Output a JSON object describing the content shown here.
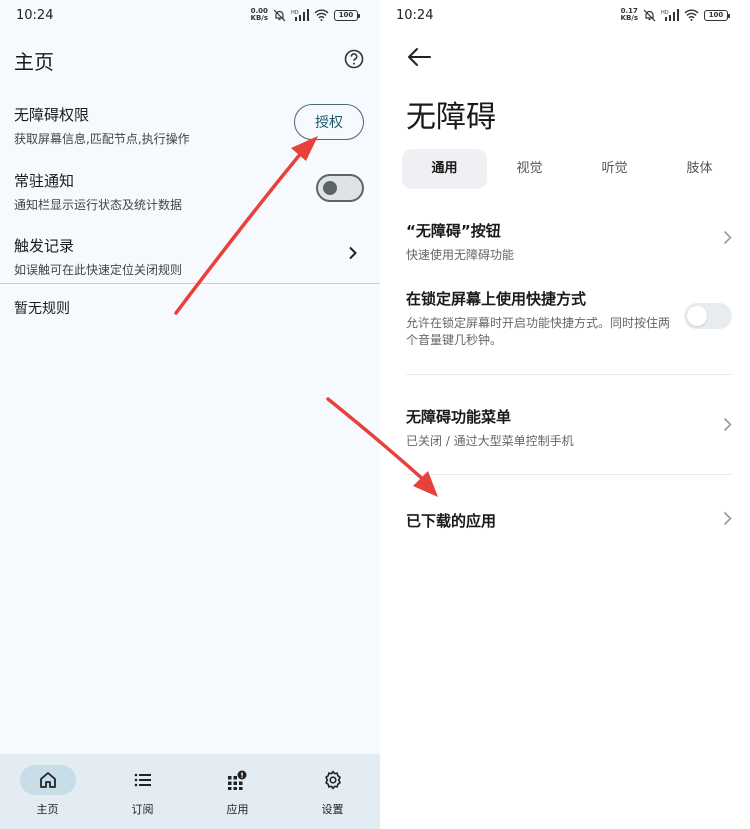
{
  "left": {
    "status": {
      "time": "10:24",
      "speed_value": "0.00",
      "speed_unit": "KB/s",
      "battery": "100"
    },
    "title": "主页",
    "rows": {
      "accessibility": {
        "title": "无障碍权限",
        "subtitle": "获取屏幕信息,匹配节点,执行操作",
        "button": "授权"
      },
      "notification": {
        "title": "常驻通知",
        "subtitle": "通知栏显示运行状态及统计数据",
        "enabled": false
      },
      "trigger_log": {
        "title": "触发记录",
        "subtitle": "如误触可在此快速定位关闭规则"
      }
    },
    "empty_text": "暂无规则",
    "nav": [
      {
        "label": "主页",
        "icon": "home-icon",
        "active": true
      },
      {
        "label": "订阅",
        "icon": "list-icon",
        "active": false
      },
      {
        "label": "应用",
        "icon": "apps-icon",
        "active": false
      },
      {
        "label": "设置",
        "icon": "gear-icon",
        "active": false
      }
    ]
  },
  "right": {
    "status": {
      "time": "10:24",
      "speed_value": "0.17",
      "speed_unit": "KB/s",
      "battery": "100"
    },
    "title": "无障碍",
    "tabs": [
      "通用",
      "视觉",
      "听觉",
      "肢体"
    ],
    "active_tab": "通用",
    "rows": {
      "a11y_button": {
        "title": "“无障碍”按钮",
        "subtitle": "快速使用无障碍功能"
      },
      "lock_shortcut": {
        "title": "在锁定屏幕上使用快捷方式",
        "subtitle": "允许在锁定屏幕时开启功能快捷方式。同时按住两个音量键几秒钟。",
        "enabled": false
      },
      "a11y_menu": {
        "title": "无障碍功能菜单",
        "subtitle": "已关闭 / 通过大型菜单控制手机"
      },
      "downloaded_apps": {
        "title": "已下载的应用"
      }
    }
  },
  "colors": {
    "annotation_arrow": "#e8413c",
    "nav_bg": "#e2ecf2",
    "active_pill": "#c7dde8"
  }
}
